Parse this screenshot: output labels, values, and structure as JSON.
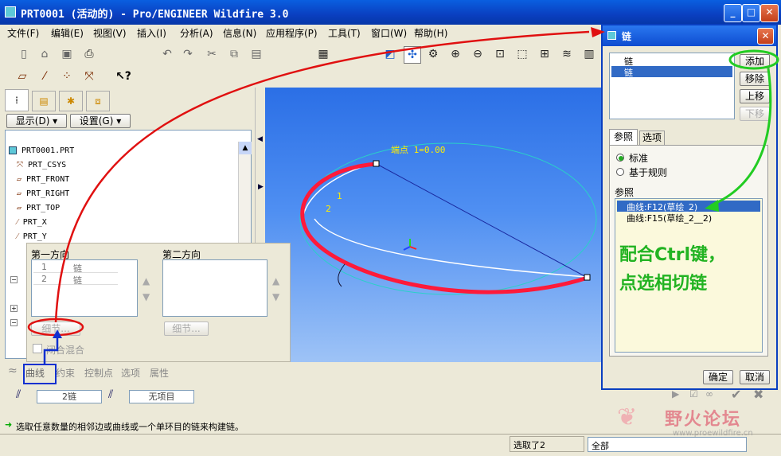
{
  "window": {
    "title": "PRT0001 (活动的) - Pro/ENGINEER Wildfire 3.0"
  },
  "menu": [
    "文件(F)",
    "编辑(E)",
    "视图(V)",
    "插入(I)",
    "分析(A)",
    "信息(N)",
    "应用程序(P)",
    "工具(T)",
    "窗口(W)",
    "帮助(H)"
  ],
  "left_tabs": {
    "show": "显示(D) ▾",
    "settings": "设置(G) ▾"
  },
  "tree": {
    "root": "PRT0001.PRT",
    "items": [
      "PRT_CSYS",
      "PRT_FRONT",
      "PRT_RIGHT",
      "PRT_TOP",
      "PRT_X",
      "PRT_Y"
    ]
  },
  "chain_panel": {
    "first_dir": "第一方向",
    "second_dir": "第二方向",
    "rows": [
      {
        "n": "1",
        "v": "链"
      },
      {
        "n": "2",
        "v": "链"
      }
    ],
    "details1": "细节...",
    "details2": "细节...",
    "closed_blend": "闭合混合"
  },
  "feature_tabs": [
    "曲线",
    "约束",
    "控制点",
    "选项",
    "属性"
  ],
  "dashboard": {
    "chains": "2链",
    "none": "无项目"
  },
  "viewport": {
    "annotation": "端点 1=0.00",
    "label1": "1",
    "label2": "2"
  },
  "dialog": {
    "title": "链",
    "list": [
      "链",
      "链"
    ],
    "add": "添加",
    "remove": "移除",
    "up": "上移",
    "down": "下移",
    "tabs": [
      "参照",
      "选项"
    ],
    "radio_standard": "标准",
    "radio_rule": "基于规则",
    "refs_label": "参照",
    "refs": [
      "曲线:F12(草绘_2)",
      "曲线:F15(草绘_2__2)"
    ],
    "annotation_line1": "配合Ctrl键，",
    "annotation_line2": "点选相切链",
    "ok": "确定",
    "cancel": "取消"
  },
  "status": {
    "message": "选取任意数量的相邻边或曲线或一个单环目的链来构建链。",
    "selected": "选取了2",
    "filter": "全部"
  },
  "watermark": {
    "text": "野火论坛",
    "url": "www.proewildfire.cn"
  }
}
